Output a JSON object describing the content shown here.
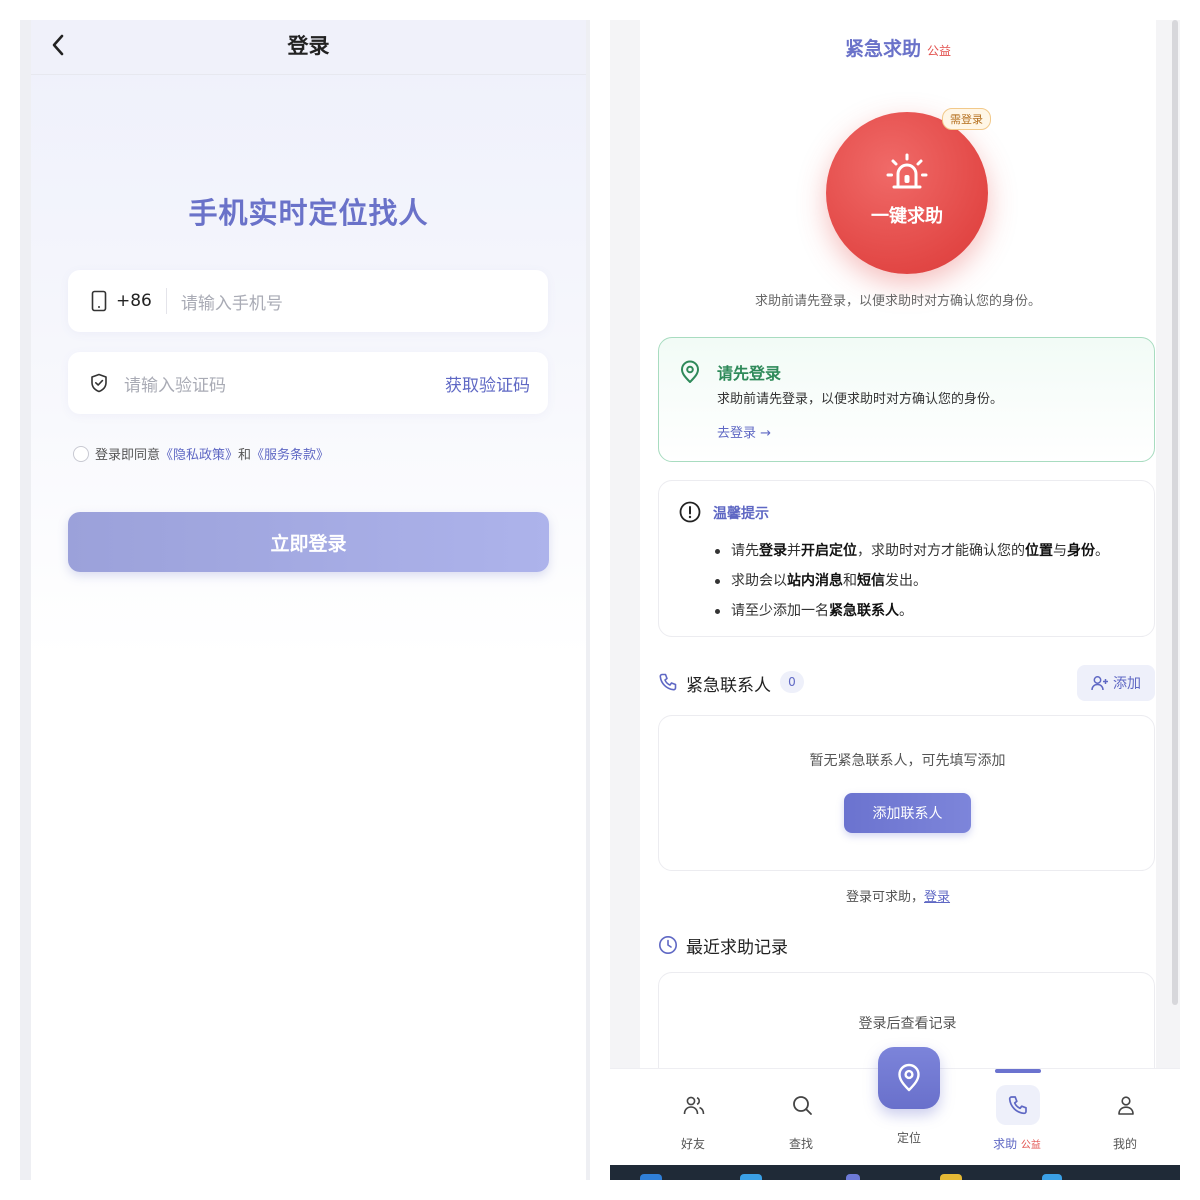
{
  "login": {
    "nav_title": "登录",
    "hero_title": "手机实时定位找人",
    "phone": {
      "country_code": "+86",
      "placeholder": "请输入手机号"
    },
    "code": {
      "placeholder": "请输入验证码",
      "get_code_label": "获取验证码"
    },
    "agreement": {
      "prefix": "登录即同意",
      "privacy": "《隐私政策》",
      "and": "和",
      "terms": "《服务条款》"
    },
    "submit_label": "立即登录"
  },
  "help": {
    "title": "紧急求助",
    "title_tag": "公益",
    "need_login_badge": "需登录",
    "sos_label": "一键求助",
    "sos_hint": "求助前请先登录，以便求助时对方确认您的身份。",
    "login_card": {
      "title": "请先登录",
      "desc": "求助前请先登录，以便求助时对方确认您的身份。",
      "link": "去登录 →"
    },
    "tips": {
      "title": "温馨提示",
      "items": [
        {
          "a": "请先",
          "b1": "登录",
          "c": "并",
          "b2": "开启定位",
          "d": "，求助时对方才能确认您的",
          "b3": "位置",
          "e": "与",
          "b4": "身份",
          "f": "。"
        },
        {
          "a": "求助会以",
          "b1": "站内消息",
          "c": "和",
          "b2": "短信",
          "d": "发出。"
        },
        {
          "a": "请至少添加一名",
          "b1": "紧急联系人",
          "c": "。"
        }
      ]
    },
    "contacts": {
      "title": "紧急联系人",
      "count": "0",
      "add_label": "添加",
      "empty_text": "暂无紧急联系人，可先填写添加",
      "add_contact_label": "添加联系人"
    },
    "login_to_help": {
      "text": "登录可求助，",
      "link": "登录"
    },
    "history": {
      "title": "最近求助记录",
      "empty_text": "登录后查看记录"
    },
    "tabs": {
      "friends": "好友",
      "find": "查找",
      "locate": "定位",
      "help": "求助",
      "help_tag": "公益",
      "mine": "我的"
    },
    "colors": {
      "accent": "#6b73cf",
      "sos": "#e24745",
      "success": "#2f8a5a"
    }
  }
}
